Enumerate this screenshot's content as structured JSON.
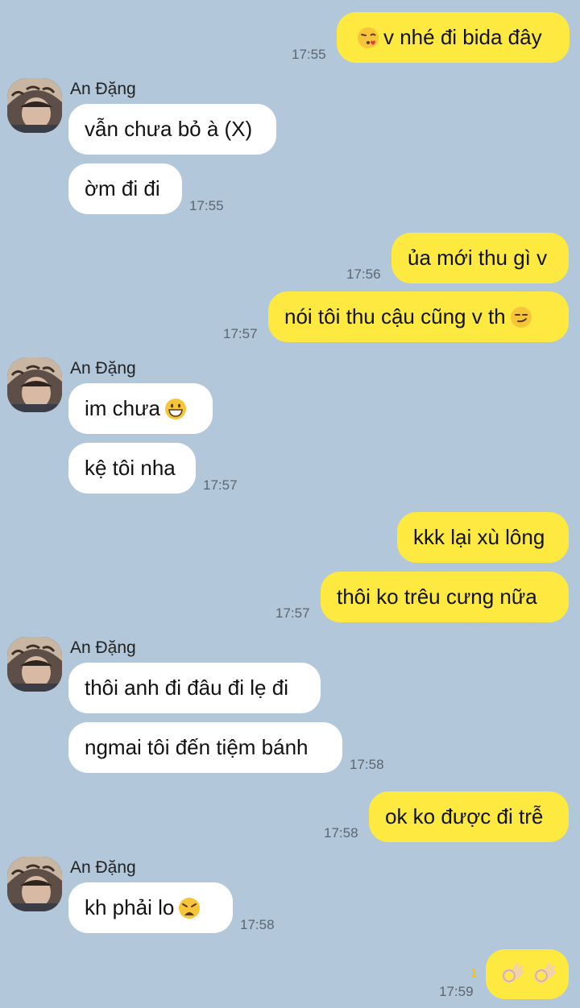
{
  "contact": {
    "name": "An Đặng"
  },
  "messages": [
    {
      "from": "me",
      "text": "v nhé đi bida đây",
      "emoji_before": "kissing-heart-emoji",
      "time": "17:55"
    },
    {
      "from": "them",
      "text": "vẫn chưa bỏ à (X)"
    },
    {
      "from": "them",
      "text": "ờm đi đi",
      "time": "17:55"
    },
    {
      "from": "me",
      "text": "ủa mới thu gì v",
      "time": "17:56"
    },
    {
      "from": "me",
      "text": "nói tôi thu cậu cũng v th",
      "emoji_after": "smirk-emoji",
      "time": "17:57"
    },
    {
      "from": "them",
      "text": "im chưa",
      "emoji_after": "grin-emoji"
    },
    {
      "from": "them",
      "text": "kệ tôi nha",
      "time": "17:57"
    },
    {
      "from": "me",
      "text": "kkk lại xù lông"
    },
    {
      "from": "me",
      "text": "thôi ko trêu cưng nữa",
      "time": "17:57"
    },
    {
      "from": "them",
      "text": "thôi anh đi đâu đi lẹ đi"
    },
    {
      "from": "them",
      "text": "ngmai tôi đến tiệm bánh",
      "time": "17:58"
    },
    {
      "from": "me",
      "text": "ok ko được đi trễ",
      "time": "17:58"
    },
    {
      "from": "them",
      "text": "kh phải lo",
      "emoji_after": "weary-emoji",
      "time": "17:58"
    },
    {
      "from": "me",
      "emoji_only": "ok-hand-emoji x2",
      "time": "17:59",
      "unread_count": "1"
    }
  ],
  "colors": {
    "background": "#b2c7da",
    "my_bubble": "#fde93f",
    "their_bubble": "#ffffff"
  }
}
